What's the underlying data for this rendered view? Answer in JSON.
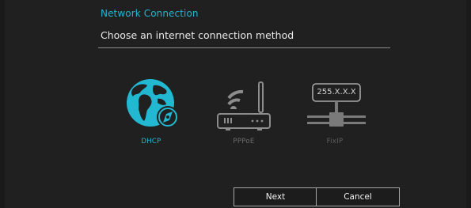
{
  "dialog": {
    "title": "Network Connection",
    "subtitle": "Choose an internet connection method"
  },
  "options": [
    {
      "id": "dhcp",
      "label": "DHCP",
      "icon": "globe-icon",
      "selected": true
    },
    {
      "id": "pppoe",
      "label": "PPPoE",
      "icon": "router-icon",
      "selected": false
    },
    {
      "id": "fixip",
      "label": "FixIP",
      "icon": "fixed-ip-icon",
      "selected": false,
      "icon_text": "255.X.X.X"
    }
  ],
  "buttons": {
    "next_label": "Next",
    "cancel_label": "Cancel"
  },
  "colors": {
    "accent": "#22b8d1",
    "inactive": "#6c6c6c",
    "background": "#202020"
  }
}
